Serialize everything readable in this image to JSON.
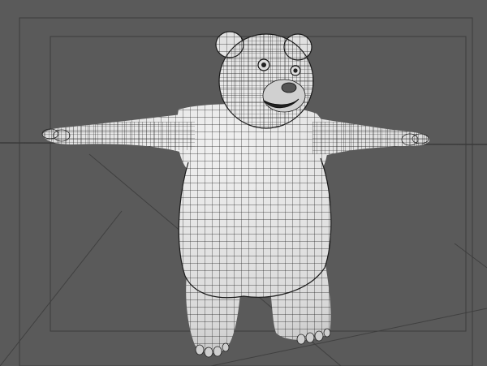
{
  "viewport": {
    "background_color": "#5a5a5a",
    "grid_line_color": "#404040",
    "frame_color": "#3c3c3c",
    "mesh_fill_color": "#e4e4e4",
    "mesh_shade_color": "#b8b8b8",
    "wire_color": "#1e1e1e",
    "view_mode": "wireframe-on-shaded",
    "model": {
      "name": "",
      "pose": "T-pose",
      "icon": "bear-model-icon"
    }
  }
}
